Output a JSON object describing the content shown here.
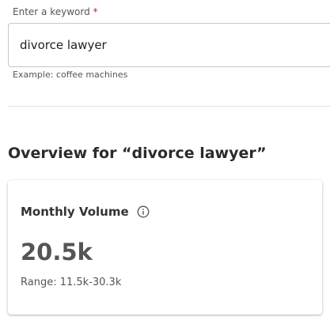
{
  "keyword_field": {
    "label": "Enter a keyword",
    "required_mark": "*",
    "value": "divorce lawyer",
    "helper": "Example: coffee machines"
  },
  "overview": {
    "heading": "Overview for “divorce lawyer”"
  },
  "monthly_volume_card": {
    "title": "Monthly Volume",
    "info_icon": "info-circle-icon",
    "value": "20.5k",
    "range": "Range: 11.5k-30.3k"
  },
  "colors": {
    "required": "#d21c1c",
    "text_primary": "#333333",
    "text_secondary": "#555555",
    "border": "#c7c7c7",
    "divider": "#e2e2e2"
  }
}
